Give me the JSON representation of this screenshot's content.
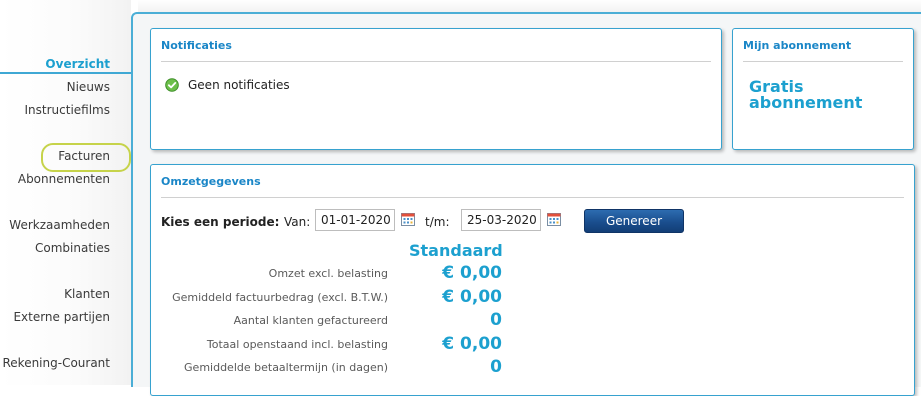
{
  "sidebar": {
    "items": [
      {
        "label": "Overzicht",
        "active": true
      },
      {
        "label": "Nieuws"
      },
      {
        "label": "Instructiefilms"
      },
      {
        "label": "Facturen",
        "highlighted": true
      },
      {
        "label": "Abonnementen"
      },
      {
        "label": "Werkzaamheden"
      },
      {
        "label": "Combinaties"
      },
      {
        "label": "Klanten"
      },
      {
        "label": "Externe partijen"
      },
      {
        "label": "Rekening-Courant"
      }
    ]
  },
  "notifications": {
    "title": "Notificaties",
    "message": "Geen notificaties",
    "icon": "check-circle-icon"
  },
  "subscription": {
    "title": "Mijn abonnement",
    "plan": "Gratis abonnement"
  },
  "revenue": {
    "title": "Omzetgegevens",
    "period_label": "Kies een periode:",
    "from_label": "Van:",
    "from_value": "01-01-2020",
    "to_label": "t/m:",
    "to_value": "25-03-2020",
    "generate_label": "Genereer",
    "column_header": "Standaard",
    "stats": [
      {
        "label": "Omzet excl. belasting",
        "value": "€ 0,00"
      },
      {
        "label": "Gemiddeld factuurbedrag (excl. B.T.W.)",
        "value": "€ 0,00"
      },
      {
        "label": "Aantal klanten gefactureerd",
        "value": "0"
      },
      {
        "label": "Totaal openstaand incl. belasting",
        "value": "€ 0,00"
      },
      {
        "label": "Gemiddelde betaaltermijn (in dagen)",
        "value": "0"
      }
    ]
  },
  "colors": {
    "accent": "#1ca0cf",
    "panel_border": "#37a2cf",
    "button": "#1a4e8e",
    "highlight": "#c6d34a"
  }
}
